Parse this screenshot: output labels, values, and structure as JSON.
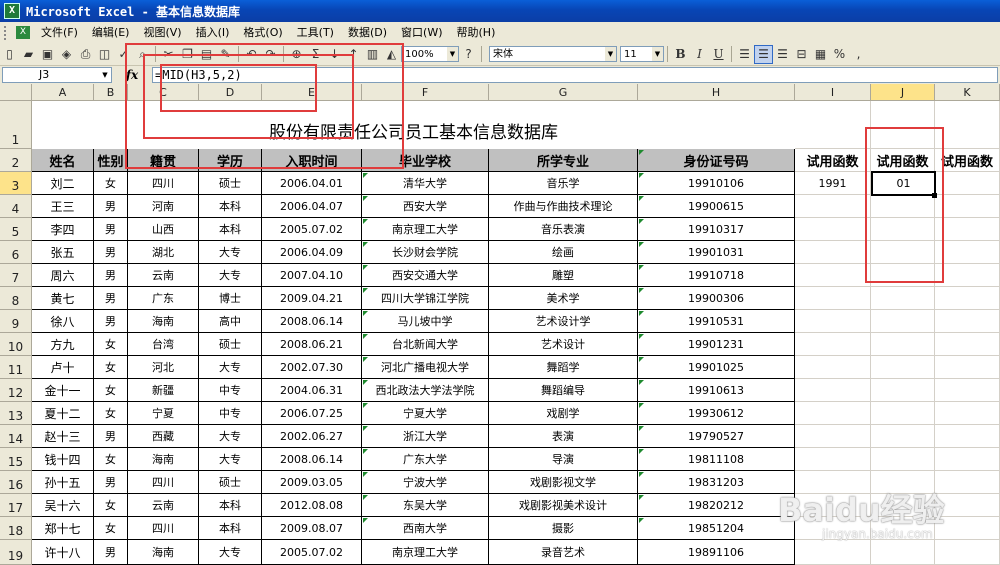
{
  "window": {
    "title": "Microsoft Excel - 基本信息数据库"
  },
  "menu": {
    "items": [
      "文件(F)",
      "编辑(E)",
      "视图(V)",
      "插入(I)",
      "格式(O)",
      "工具(T)",
      "数据(D)",
      "窗口(W)",
      "帮助(H)"
    ]
  },
  "toolbar": {
    "zoom": "100%",
    "font_name": "宋体",
    "font_size": "11",
    "bold": "B",
    "italic": "I",
    "underline": "U",
    "percent": "%",
    "comma": ","
  },
  "formula_bar": {
    "name_box": "J3",
    "fx": "fx",
    "formula": "=MID(H3,5,2)"
  },
  "columns": [
    "A",
    "B",
    "C",
    "D",
    "E",
    "F",
    "G",
    "H",
    "I",
    "J",
    "K"
  ],
  "rows": [
    "1",
    "2",
    "3",
    "4",
    "5",
    "6",
    "7",
    "8",
    "9",
    "10",
    "11",
    "12",
    "13",
    "14",
    "15",
    "16",
    "17",
    "18",
    "19"
  ],
  "sheet": {
    "title": "股份有限责任公司员工基本信息数据库",
    "headers": [
      "姓名",
      "性别",
      "籍贯",
      "学历",
      "入职时间",
      "毕业学校",
      "所学专业",
      "身份证号码"
    ],
    "extra_headers": [
      "试用函数",
      "试用函数",
      "试用函数"
    ],
    "i3_value": "1991",
    "j3_value": "01",
    "records": [
      [
        "刘二",
        "女",
        "四川",
        "硕士",
        "2006.04.01",
        "清华大学",
        "音乐学",
        "19910106"
      ],
      [
        "王三",
        "男",
        "河南",
        "本科",
        "2006.04.07",
        "西安大学",
        "作曲与作曲技术理论",
        "19900615"
      ],
      [
        "李四",
        "男",
        "山西",
        "本科",
        "2005.07.02",
        "南京理工大学",
        "音乐表演",
        "19910317"
      ],
      [
        "张五",
        "男",
        "湖北",
        "大专",
        "2006.04.09",
        "长沙财会学院",
        "绘画",
        "19901031"
      ],
      [
        "周六",
        "男",
        "云南",
        "大专",
        "2007.04.10",
        "西安交通大学",
        "雕塑",
        "19910718"
      ],
      [
        "黄七",
        "男",
        "广东",
        "博士",
        "2009.04.21",
        "四川大学锦江学院",
        "美术学",
        "19900306"
      ],
      [
        "徐八",
        "男",
        "海南",
        "高中",
        "2008.06.14",
        "马儿坡中学",
        "艺术设计学",
        "19910531"
      ],
      [
        "方九",
        "女",
        "台湾",
        "硕士",
        "2008.06.21",
        "台北新闻大学",
        "艺术设计",
        "19901231"
      ],
      [
        "卢十",
        "女",
        "河北",
        "大专",
        "2002.07.30",
        "河北广播电视大学",
        "舞蹈学",
        "19901025"
      ],
      [
        "金十一",
        "女",
        "新疆",
        "中专",
        "2004.06.31",
        "西北政法大学法学院",
        "舞蹈编导",
        "19910613"
      ],
      [
        "夏十二",
        "女",
        "宁夏",
        "中专",
        "2006.07.25",
        "宁夏大学",
        "戏剧学",
        "19930612"
      ],
      [
        "赵十三",
        "男",
        "西藏",
        "大专",
        "2002.06.27",
        "浙江大学",
        "表演",
        "19790527"
      ],
      [
        "钱十四",
        "女",
        "海南",
        "大专",
        "2008.06.14",
        "广东大学",
        "导演",
        "19811108"
      ],
      [
        "孙十五",
        "男",
        "四川",
        "硕士",
        "2009.03.05",
        "宁波大学",
        "戏剧影视文学",
        "19831203"
      ],
      [
        "吴十六",
        "女",
        "云南",
        "本科",
        "2012.08.08",
        "东吴大学",
        "戏剧影视美术设计",
        "19820212"
      ],
      [
        "郑十七",
        "女",
        "四川",
        "本科",
        "2009.08.07",
        "西南大学",
        "摄影",
        "19851204"
      ],
      [
        "许十八",
        "男",
        "海南",
        "大专",
        "2005.07.02",
        "南京理工大学",
        "录音艺术",
        "19891106"
      ]
    ]
  },
  "watermark": {
    "text": "Baidu经验",
    "sub": "jingyan.baidu.com"
  },
  "colors": {
    "title_bar": "#0845b5",
    "highlight_box": "#e03c3c",
    "header_fill": "#c0c0c0"
  }
}
